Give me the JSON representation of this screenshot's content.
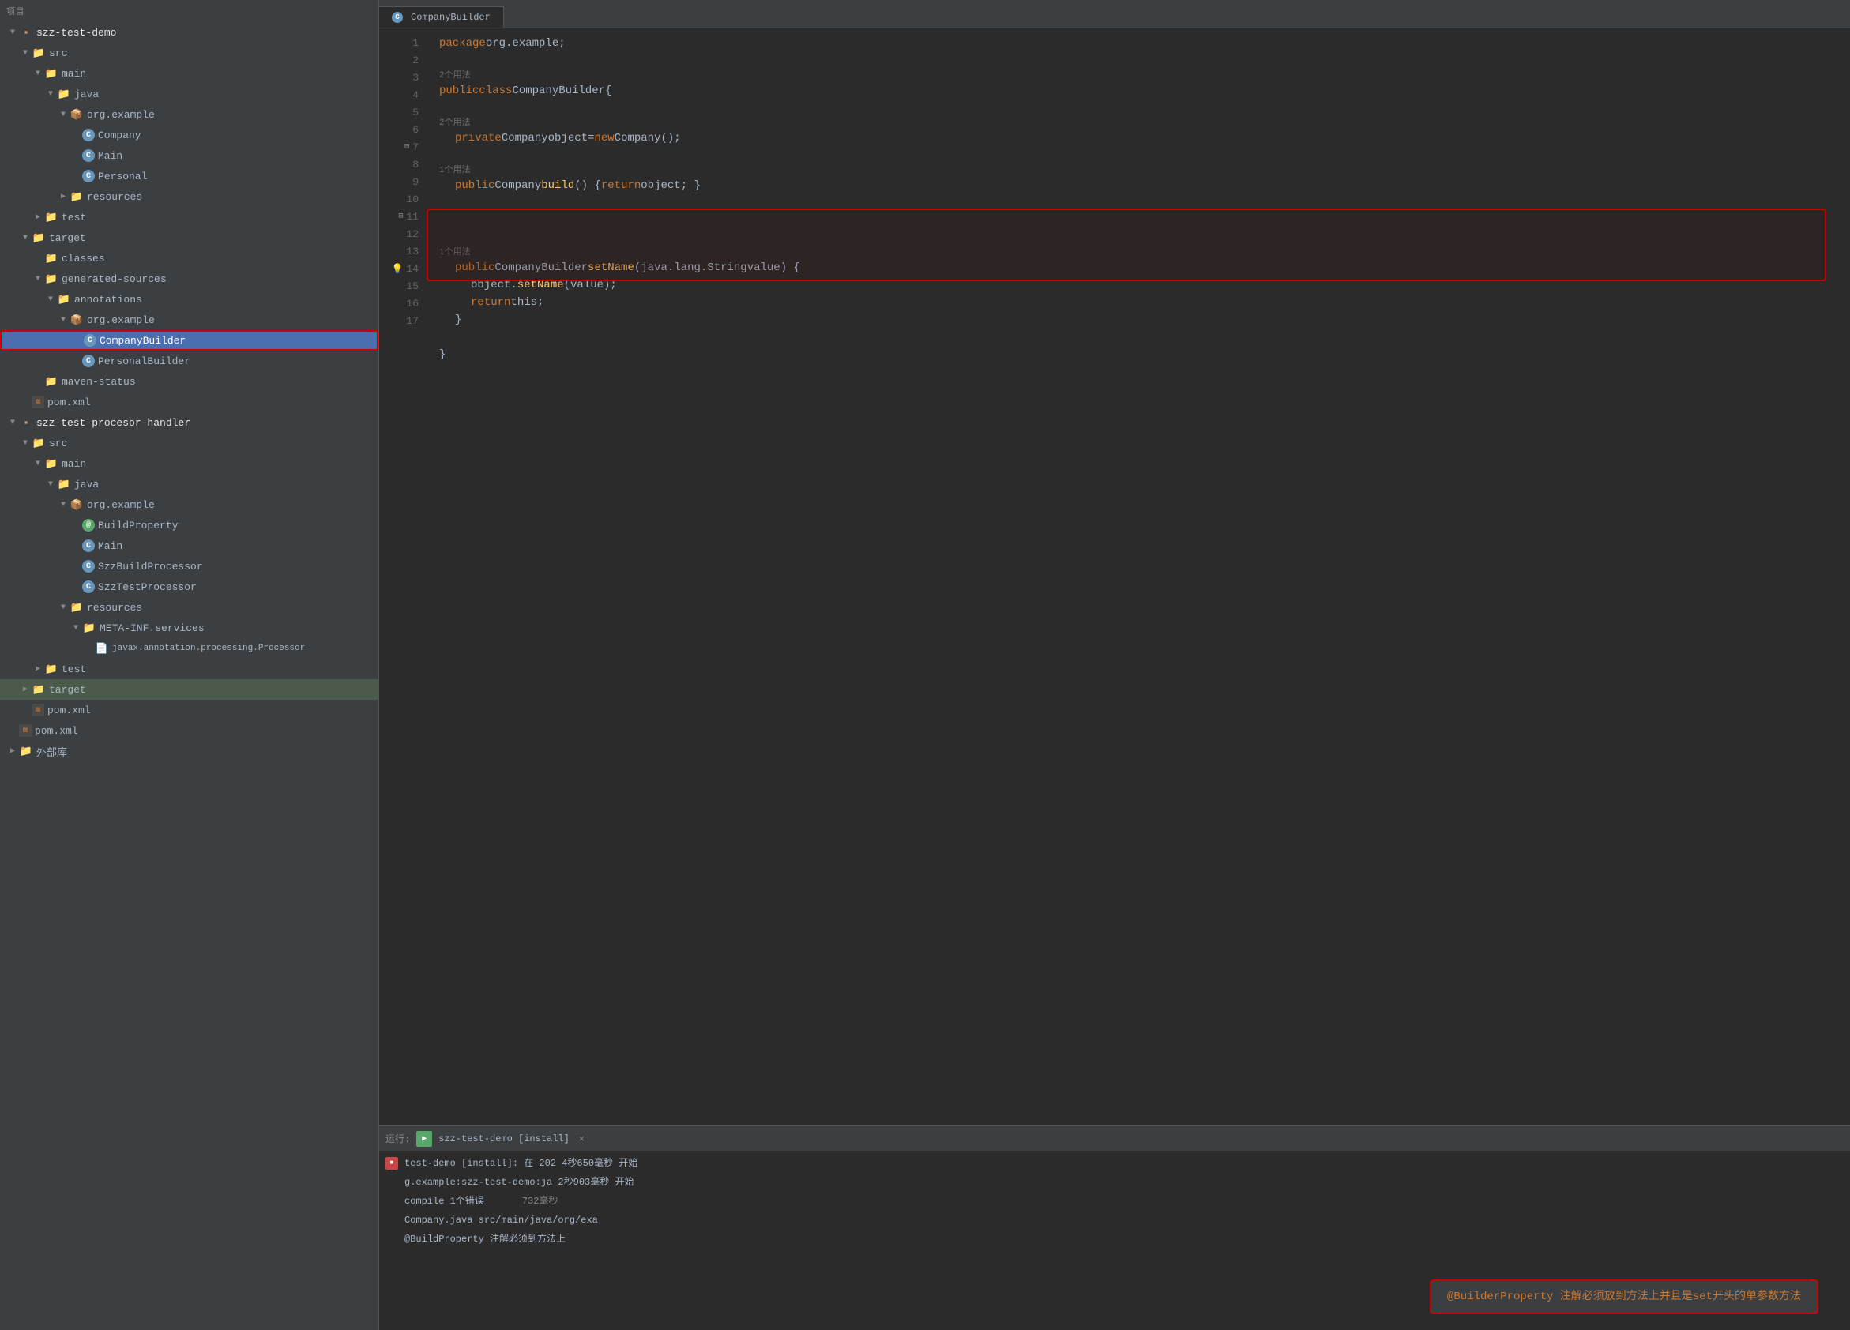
{
  "sidebar": {
    "title": "PROJECT",
    "root_project": "szz-test-demo",
    "items": [
      {
        "id": "szz-test-demo",
        "label": "szz-test-demo",
        "type": "root",
        "indent": 1,
        "expanded": true
      },
      {
        "id": "src",
        "label": "src",
        "type": "folder",
        "indent": 2,
        "expanded": true
      },
      {
        "id": "main",
        "label": "main",
        "type": "folder",
        "indent": 3,
        "expanded": true
      },
      {
        "id": "java",
        "label": "java",
        "type": "folder-blue",
        "indent": 4,
        "expanded": true
      },
      {
        "id": "org.example",
        "label": "org.example",
        "type": "pkg",
        "indent": 5,
        "expanded": true
      },
      {
        "id": "Company",
        "label": "Company",
        "type": "class-blue",
        "indent": 6
      },
      {
        "id": "Main",
        "label": "Main",
        "type": "class-blue",
        "indent": 6
      },
      {
        "id": "Personal",
        "label": "Personal",
        "type": "class-blue",
        "indent": 6
      },
      {
        "id": "resources",
        "label": "resources",
        "type": "folder",
        "indent": 5
      },
      {
        "id": "test",
        "label": "test",
        "type": "folder",
        "indent": 3,
        "expanded": false
      },
      {
        "id": "target",
        "label": "target",
        "type": "folder-orange",
        "indent": 2,
        "expanded": true
      },
      {
        "id": "classes",
        "label": "classes",
        "type": "folder",
        "indent": 3
      },
      {
        "id": "generated-sources",
        "label": "generated-sources",
        "type": "folder",
        "indent": 3,
        "expanded": true
      },
      {
        "id": "annotations",
        "label": "annotations",
        "type": "folder-annotation",
        "indent": 4,
        "expanded": true
      },
      {
        "id": "org.example2",
        "label": "org.example",
        "type": "pkg",
        "indent": 5,
        "expanded": true
      },
      {
        "id": "CompanyBuilder",
        "label": "CompanyBuilder",
        "type": "class-blue",
        "indent": 6,
        "selected": true
      },
      {
        "id": "PersonalBuilder",
        "label": "PersonalBuilder",
        "type": "class-blue",
        "indent": 6
      },
      {
        "id": "maven-status",
        "label": "maven-status",
        "type": "folder",
        "indent": 3
      },
      {
        "id": "pom.xml1",
        "label": "pom.xml",
        "type": "maven",
        "indent": 2
      },
      {
        "id": "szz-test-procesor-handler",
        "label": "szz-test-procesor-handler",
        "type": "root2",
        "indent": 1,
        "expanded": true
      },
      {
        "id": "src2",
        "label": "src",
        "type": "folder",
        "indent": 2,
        "expanded": true
      },
      {
        "id": "main2",
        "label": "main",
        "type": "folder",
        "indent": 3,
        "expanded": true
      },
      {
        "id": "java2",
        "label": "java",
        "type": "folder-blue",
        "indent": 4,
        "expanded": true
      },
      {
        "id": "org.example3",
        "label": "org.example",
        "type": "pkg",
        "indent": 5,
        "expanded": true
      },
      {
        "id": "BuildProperty",
        "label": "BuildProperty",
        "type": "class-green",
        "indent": 6
      },
      {
        "id": "Main2",
        "label": "Main",
        "type": "class-blue",
        "indent": 6
      },
      {
        "id": "SzzBuildProcessor",
        "label": "SzzBuildProcessor",
        "type": "class-blue",
        "indent": 6
      },
      {
        "id": "SzzTestProcessor",
        "label": "SzzTestProcessor",
        "type": "class-blue",
        "indent": 6
      },
      {
        "id": "resources2",
        "label": "resources",
        "type": "folder",
        "indent": 5,
        "expanded": true
      },
      {
        "id": "META-INF.services",
        "label": "META-INF.services",
        "type": "folder",
        "indent": 6,
        "expanded": true
      },
      {
        "id": "javax.annotation",
        "label": "javax.annotation.processing.Processor",
        "type": "file",
        "indent": 7
      },
      {
        "id": "test2",
        "label": "test",
        "type": "folder",
        "indent": 3,
        "expanded": false
      },
      {
        "id": "target2",
        "label": "target",
        "type": "folder-orange",
        "indent": 2,
        "expanded": false
      },
      {
        "id": "pom.xml2",
        "label": "pom.xml",
        "type": "maven",
        "indent": 2
      },
      {
        "id": "pom.xml3",
        "label": "pom.xml",
        "type": "maven",
        "indent": 1
      },
      {
        "id": "external-libs",
        "label": "外部库",
        "type": "folder",
        "indent": 1
      }
    ]
  },
  "editor": {
    "tab_label": "CompanyBuilder",
    "lines": [
      {
        "num": 1,
        "content": "package org.example;",
        "type": "code"
      },
      {
        "num": 2,
        "content": "",
        "type": "empty"
      },
      {
        "num": 3,
        "content": "public class CompanyBuilder {",
        "type": "code",
        "hint": "2个用法"
      },
      {
        "num": 4,
        "content": "",
        "type": "empty"
      },
      {
        "num": 5,
        "content": "    private Company object = new Company();",
        "type": "code",
        "hint": "2个用法"
      },
      {
        "num": 6,
        "content": "",
        "type": "empty"
      },
      {
        "num": 7,
        "content": "    public Company build() { return object; }",
        "type": "code",
        "hint": "1个用法"
      },
      {
        "num": 8,
        "content": "",
        "type": "empty"
      },
      {
        "num": 9,
        "content": "",
        "type": "empty"
      },
      {
        "num": 10,
        "content": "",
        "type": "empty"
      },
      {
        "num": 11,
        "content": "    public CompanyBuilder setName(java.lang.String value) {",
        "type": "code",
        "hint": "1个用法"
      },
      {
        "num": 12,
        "content": "        object.setName(value);",
        "type": "code"
      },
      {
        "num": 13,
        "content": "        return this;",
        "type": "code"
      },
      {
        "num": 14,
        "content": "    }",
        "type": "code",
        "lightbulb": true
      },
      {
        "num": 15,
        "content": "",
        "type": "empty"
      },
      {
        "num": 16,
        "content": "}",
        "type": "code"
      },
      {
        "num": 17,
        "content": "",
        "type": "empty"
      }
    ]
  },
  "bottom": {
    "run_label": "运行:",
    "run_tab": "szz-test-demo [install]",
    "lines": [
      {
        "text": "test-demo [install]: 在 202 4秒650毫秒 开始",
        "type": "info"
      },
      {
        "text": "g.example:szz-test-demo:ja 2秒903毫秒 开始",
        "type": "info"
      },
      {
        "text": "compile 1个错误    732毫秒",
        "type": "error"
      },
      {
        "text": "Company.java src/main/java/org/exa",
        "type": "info"
      },
      {
        "text": "@BuildProperty 注解必须到方法上",
        "type": "info"
      }
    ],
    "popup_text": "@BuilderProperty 注解必须放到方法上并且是set开头的单参数方法"
  }
}
